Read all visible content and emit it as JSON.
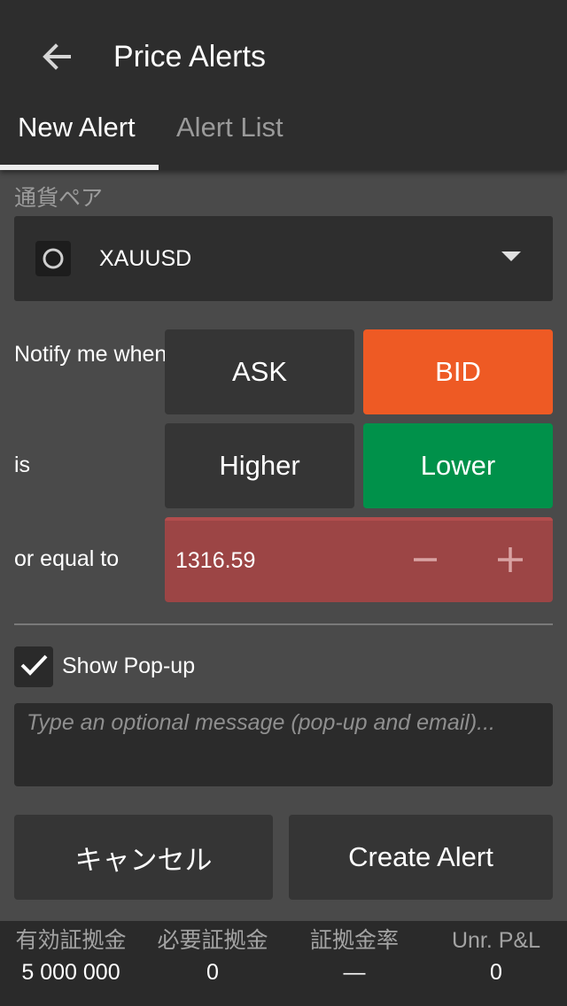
{
  "header": {
    "title": "Price Alerts",
    "back_icon": "arrow-left-icon"
  },
  "tabs": [
    {
      "label": "New Alert",
      "active": true
    },
    {
      "label": "Alert List",
      "active": false
    }
  ],
  "currency": {
    "label": "通貨ペア",
    "value": "XAUUSD"
  },
  "notify": {
    "label": "Notify me when",
    "options": [
      "ASK",
      "BID"
    ],
    "selected": "BID"
  },
  "direction": {
    "label": "is",
    "options": [
      "Higher",
      "Lower"
    ],
    "selected": "Lower"
  },
  "price": {
    "label": "or equal to",
    "value": "1316.59"
  },
  "popup": {
    "label": "Show Pop-up",
    "checked": true
  },
  "message": {
    "placeholder": "Type an optional message (pop-up and email)...",
    "value": ""
  },
  "actions": {
    "cancel": "キャンセル",
    "create": "Create Alert"
  },
  "footer": {
    "stats": [
      {
        "label": "有効証拠金",
        "value": "5 000 000"
      },
      {
        "label": "必要証拠金",
        "value": "0"
      },
      {
        "label": "証拠金率",
        "value": "—"
      },
      {
        "label": "Unr. P&L",
        "value": "0"
      }
    ]
  },
  "colors": {
    "bid_active": "#ee5a24",
    "lower_active": "#00914a",
    "price_box": "#9c4545",
    "background": "#4a4a4a",
    "topbar": "#2d2d2d"
  }
}
